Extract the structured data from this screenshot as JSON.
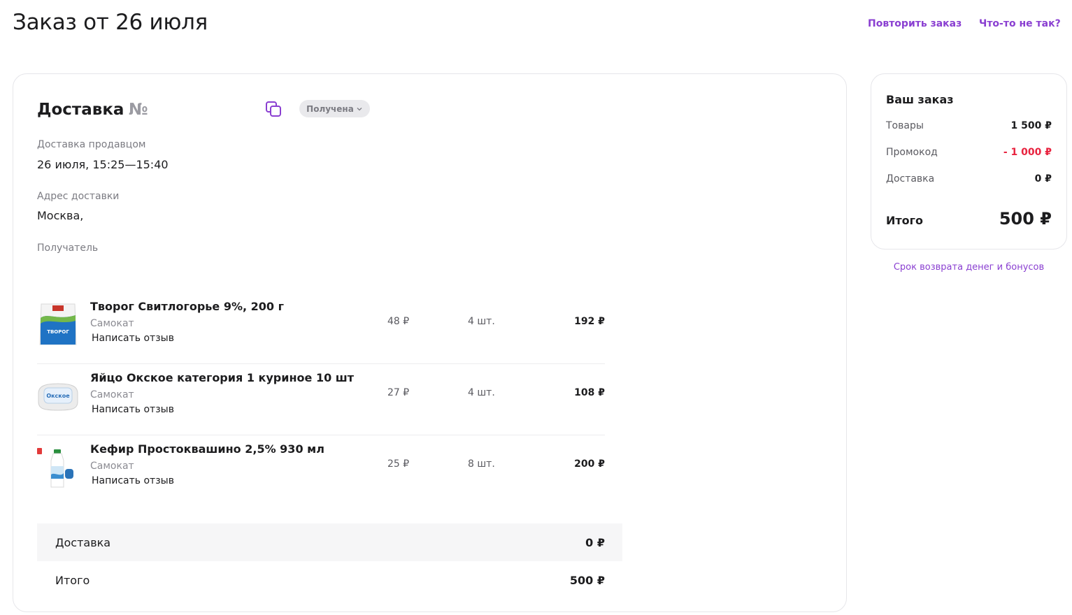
{
  "header": {
    "title": "Заказ от 26 июля",
    "repeat_label": "Повторить заказ",
    "problem_label": "Что-то не так?"
  },
  "delivery": {
    "title": "Доставка",
    "number_label": "№",
    "status": "Получена",
    "method_label": "Доставка продавцом",
    "time": "26 июля, 15:25—15:40",
    "address_label": "Адрес доставки",
    "address": "Москва,",
    "recipient_label": "Получатель"
  },
  "items": [
    {
      "name": "Творог Свитлогорье 9%, 200 г",
      "seller": "Самокат",
      "review": "Написать отзыв",
      "price": "48 ₽",
      "qty": "4 шт.",
      "total": "192 ₽",
      "image_icon": "cottage-cheese-pack",
      "image_text": "ТВОРОГ"
    },
    {
      "name": "Яйцо Окское категория 1 куриное 10 шт",
      "seller": "Самокат",
      "review": "Написать отзыв",
      "price": "27 ₽",
      "qty": "4 шт.",
      "total": "108 ₽",
      "image_icon": "egg-carton",
      "image_text": "Окское"
    },
    {
      "name": "Кефир Простоквашино 2,5% 930 мл",
      "seller": "Самокат",
      "review": "Написать отзыв",
      "price": "25 ₽",
      "qty": "8 шт.",
      "total": "200 ₽",
      "image_icon": "kefir-bottle",
      "image_text": ""
    }
  ],
  "summary": {
    "delivery_label": "Доставка",
    "delivery_value": "0 ₽",
    "total_label": "Итого",
    "total_value": "500 ₽"
  },
  "sidebar": {
    "title": "Ваш заказ",
    "goods_label": "Товары",
    "goods_value": "1 500 ₽",
    "promo_label": "Промокод",
    "promo_value": "- 1 000 ₽",
    "delivery_label": "Доставка",
    "delivery_value": "0 ₽",
    "total_label": "Итого",
    "total_value": "500 ₽",
    "refund_link": "Срок возврата денег и бонусов"
  },
  "colors": {
    "accent": "#8a3fd1",
    "promo": "#e8233f",
    "badge_bg": "#e9e9ec"
  }
}
